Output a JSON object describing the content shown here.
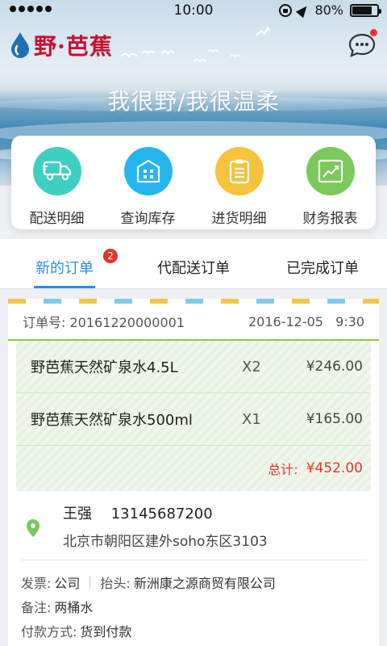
{
  "status_bar": {
    "time": "10:00",
    "battery": "80%",
    "battery_level": 0.8
  },
  "brand": {
    "name": "野·芭蕉"
  },
  "hero": {
    "slogan": "我很野/我很温柔"
  },
  "quick_menu": [
    {
      "label": "配送明细",
      "icon": "truck-icon",
      "color": "#3dd0c2"
    },
    {
      "label": "查询库存",
      "icon": "warehouse-icon",
      "color": "#25b5ee"
    },
    {
      "label": "进货明细",
      "icon": "clipboard-icon",
      "color": "#f5c33c"
    },
    {
      "label": "财务报表",
      "icon": "chart-icon",
      "color": "#7ac95b"
    }
  ],
  "tabs": [
    {
      "label": "新的订单",
      "badge": "2",
      "active": true
    },
    {
      "label": "代配送订单"
    },
    {
      "label": "已完成订单"
    }
  ],
  "order": {
    "number_label": "订单号:",
    "number": "20161220000001",
    "date": "2016-12-05",
    "time": "9:30",
    "items": [
      {
        "name": "野芭蕉天然矿泉水4.5L",
        "qty": "X2",
        "price": "¥246.00"
      },
      {
        "name": "野芭蕉天然矿泉水500ml",
        "qty": "X1",
        "price": "¥165.00"
      }
    ],
    "total_label": "总计:",
    "total": "¥452.00",
    "contact": {
      "name": "王强",
      "phone": "13145687200",
      "address": "北京市朝阳区建外soho东区3103"
    },
    "invoice_label": "发票:",
    "invoice": "公司",
    "title_label": "抬头:",
    "title": "新洲康之源商贸有限公司",
    "note_label": "备注:",
    "note": "两桶水",
    "payment_label": "付款方式:",
    "payment": "货到付款"
  },
  "colors": {
    "accent": "#2c8ce0",
    "brand_red": "#c8102e",
    "alert": "#e5342b",
    "divider_green": "#8ec63f"
  }
}
